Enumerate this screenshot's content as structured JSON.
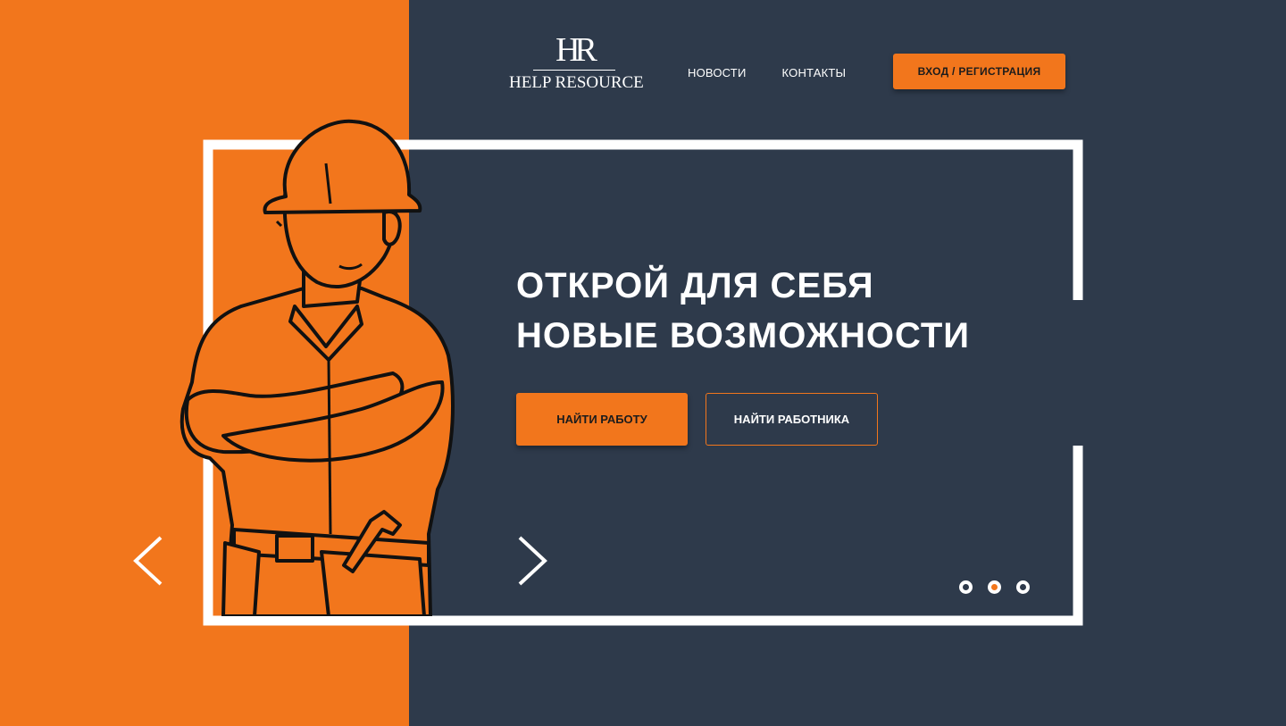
{
  "brand": {
    "mark": "HR",
    "name": "HELP RESOURCE"
  },
  "nav": {
    "items": [
      "НОВОСТИ",
      "КОНТАКТЫ"
    ]
  },
  "header": {
    "login_label": "ВХОД / РЕГИСТРАЦИЯ"
  },
  "hero": {
    "line1": "ОТКРОЙ ДЛЯ СЕБЯ",
    "line2": "НОВЫЕ ВОЗМОЖНОСТИ",
    "find_job_label": "НАЙТИ РАБОТУ",
    "find_worker_label": "НАЙТИ РАБОТНИКА"
  },
  "slider": {
    "prev_icon": "chevron-left-icon",
    "next_icon": "chevron-right-icon",
    "slide_count": 3,
    "active_index": 1
  },
  "colors": {
    "accent": "#f2761c",
    "background": "#2e3a4b",
    "text": "#ffffff"
  }
}
